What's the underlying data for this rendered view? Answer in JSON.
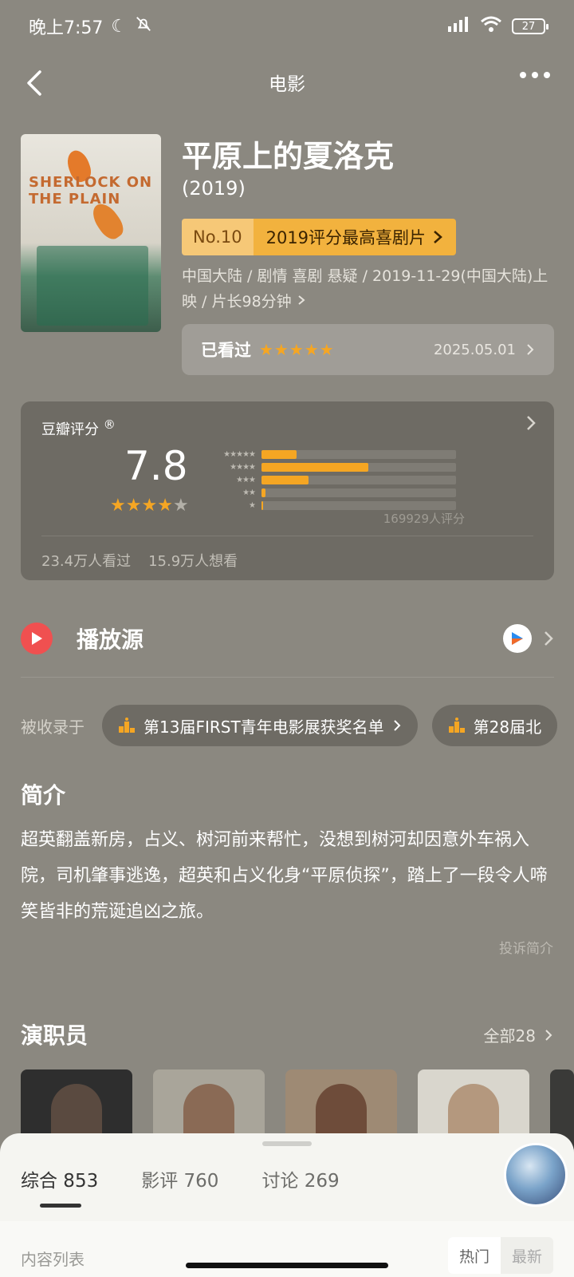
{
  "status_bar": {
    "time": "晚上7:57",
    "battery": "27"
  },
  "nav": {
    "title": "电影"
  },
  "movie": {
    "title": "平原上的夏洛克",
    "year": "(2019)",
    "rank_no": "No.10",
    "rank_label": "2019评分最高喜剧片",
    "meta": "中国大陆 / 剧情 喜剧 悬疑 / 2019-11-29(中国大陆)上映 / 片长98分钟",
    "poster_text": "SHERLOCK ON THE PLAIN"
  },
  "watched": {
    "label": "已看过",
    "stars": "★★★★★",
    "date": "2025.05.01"
  },
  "rating": {
    "label": "豆瓣评分",
    "registered": "®",
    "score": "7.8",
    "star_level": 4,
    "distribution": [
      {
        "stars": "★★★★★",
        "fraction": 0.18
      },
      {
        "stars": "★★★★",
        "fraction": 0.55
      },
      {
        "stars": "★★★",
        "fraction": 0.24
      },
      {
        "stars": "★★",
        "fraction": 0.02
      },
      {
        "stars": "★",
        "fraction": 0.01
      }
    ],
    "voters": "169929人评分",
    "watched_count": "23.4万人看过",
    "want_count": "15.9万人想看"
  },
  "play_source": {
    "label": "播放源"
  },
  "included": {
    "label": "被收录于",
    "chips": [
      "第13届FIRST青年电影展获奖名单",
      "第28届北"
    ]
  },
  "intro": {
    "title": "简介",
    "text": "超英翻盖新房，占义、树河前来帮忙，没想到树河却因意外车祸入院，司机肇事逃逸，超英和占义化身“平原侦探”，踏上了一段令人啼笑皆非的荒诞追凶之旅。",
    "complaint": "投诉简介"
  },
  "cast": {
    "title": "演职员",
    "all": "全部28"
  },
  "sheet": {
    "tabs": [
      "综合 853",
      "影评 760",
      "讨论 269"
    ],
    "content_list": "内容列表",
    "sort_hot": "热门",
    "sort_new": "最新"
  },
  "colors": {
    "background": "#8b8880",
    "accent_gold": "#f5a623",
    "play_red": "#f05050"
  }
}
